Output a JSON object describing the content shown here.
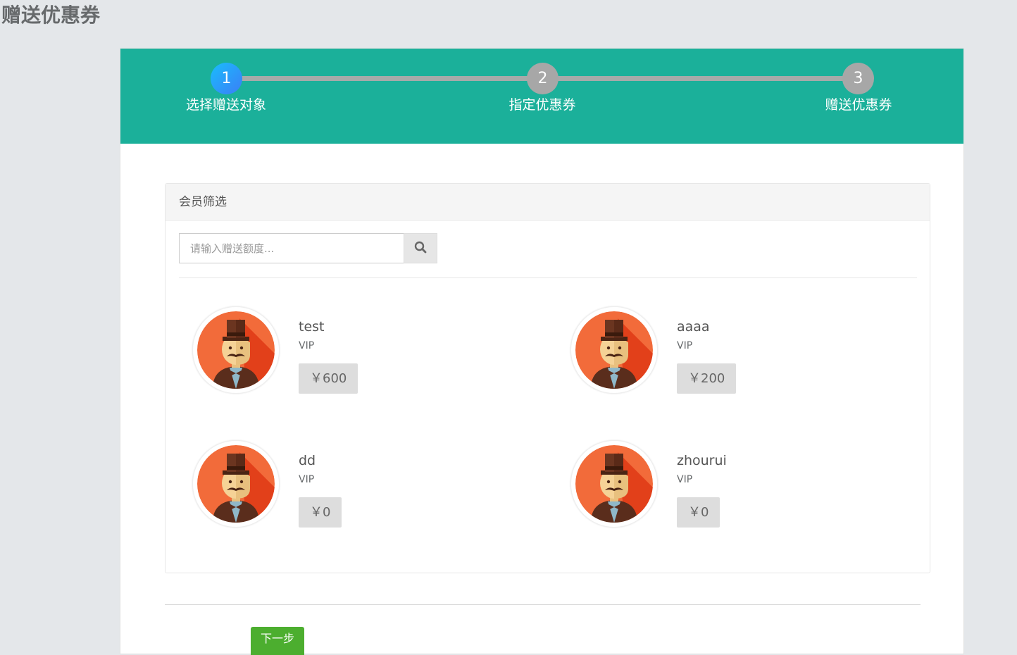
{
  "page": {
    "title": "赠送优惠券"
  },
  "steps": [
    {
      "number": "1",
      "label": "选择赠送对象",
      "active": true
    },
    {
      "number": "2",
      "label": "指定优惠券",
      "active": false
    },
    {
      "number": "3",
      "label": "赠送优惠券",
      "active": false
    }
  ],
  "filter": {
    "title": "会员筛选",
    "search_placeholder": "请输入赠送额度...",
    "search_value": ""
  },
  "members": [
    {
      "name": "test",
      "level": "VIP",
      "amount": "￥600"
    },
    {
      "name": "aaaa",
      "level": "VIP",
      "amount": "￥200"
    },
    {
      "name": "dd",
      "level": "VIP",
      "amount": "￥0"
    },
    {
      "name": "zhourui",
      "level": "VIP",
      "amount": "￥0"
    }
  ],
  "actions": {
    "next_label": "下一步"
  },
  "colors": {
    "header_bg": "#1bb09a",
    "active_step": "#2a9cf9",
    "inactive_step": "#a7a7a7",
    "next_button": "#4cae2f",
    "amount_badge": "#dddddd"
  },
  "icons": {
    "search": "search-icon",
    "avatar": "gentleman-avatar-icon"
  }
}
